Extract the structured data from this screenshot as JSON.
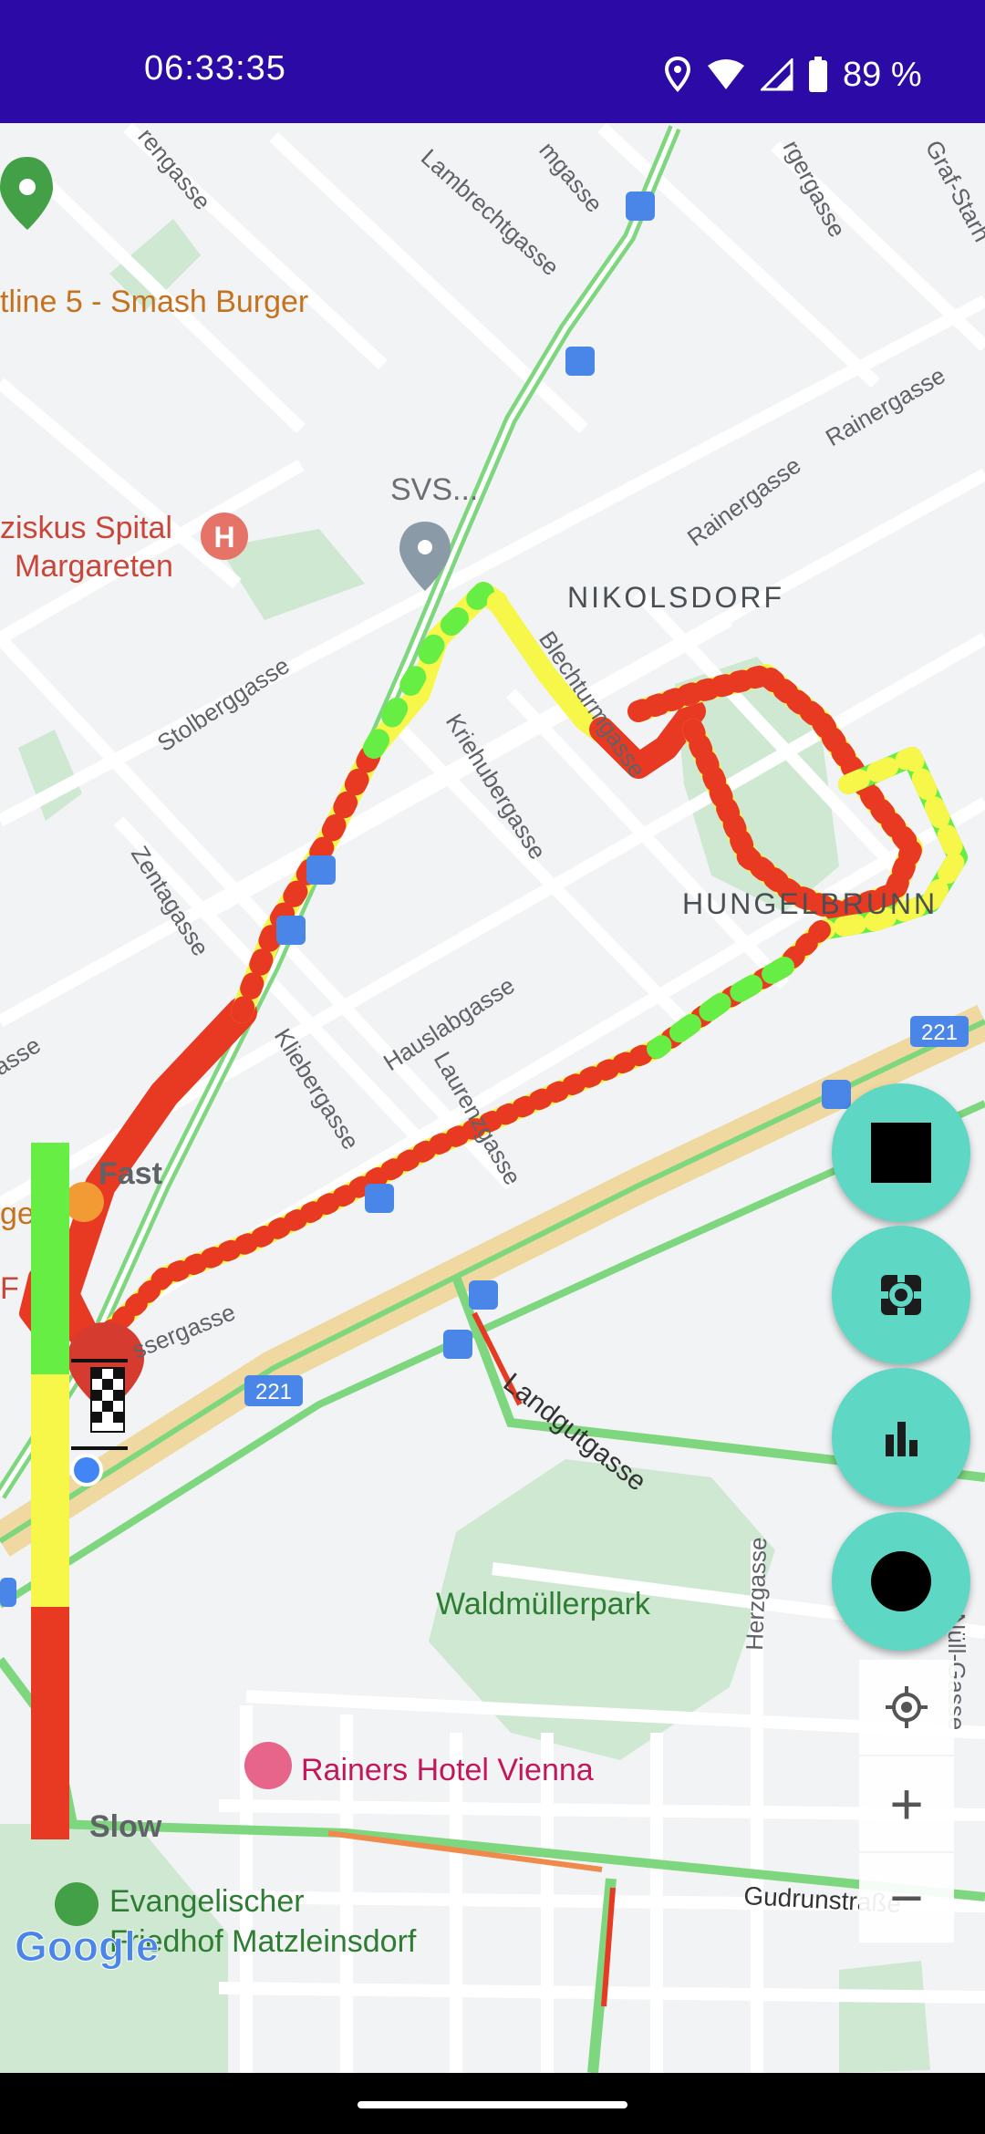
{
  "status_bar": {
    "time": "06:33:35",
    "battery": "89 %",
    "icons": [
      "location-icon",
      "wifi-icon",
      "signal-icon",
      "battery-icon"
    ]
  },
  "map": {
    "street_labels": [
      "Lambrechtgasse",
      "mgasse",
      "rgergasse",
      "Graf-Starh",
      "rengasse",
      "Rainergasse",
      "Rainergasse",
      "Stolberggasse",
      "Zentagasse",
      "Kriehubergasse",
      "Blechturmgasse",
      "Kliebergasse",
      "Hauslabgasse",
      "Laurenzgasse",
      "asse",
      "ssergasse",
      "Landgutgasse",
      "Herzgasse",
      "Gudrunstraße",
      "-Nüll-Gasse"
    ],
    "district_labels": [
      "NIKOLSDORF",
      "HUNGELBRUNN"
    ],
    "poi_labels": {
      "burger": "tline 5 - Smash Burger",
      "svs": "SVS...",
      "spital_line1": "ziskus Spital",
      "spital_line2": "Margareten",
      "fast_food": "ge",
      "f_edge": "F",
      "park": "Waldmüllerpark",
      "hotel": "Rainers Hotel Vienna",
      "cemetery_line1": "Evangelischer",
      "cemetery_line2": "Friedhof Matzleinsdorf"
    },
    "route_shields": [
      "221",
      "221"
    ],
    "google_logo": "Google"
  },
  "speed_legend": {
    "fast_label": "Fast",
    "slow_label": "Slow",
    "colors": {
      "fast": "#66ee44",
      "medium": "#f7f74a",
      "slow": "#e83a22"
    }
  },
  "fabs": {
    "stop": "stop-icon",
    "settings": "gear-icon",
    "stats": "bar-chart-icon",
    "record": "record-icon"
  },
  "map_controls": {
    "my_location": "my-location-icon",
    "zoom_in": "+",
    "zoom_out": "−"
  },
  "colors": {
    "status_bar": "#2b0aa6",
    "fab": "#5ed8c4",
    "road_highlight": "#7ed67e"
  }
}
